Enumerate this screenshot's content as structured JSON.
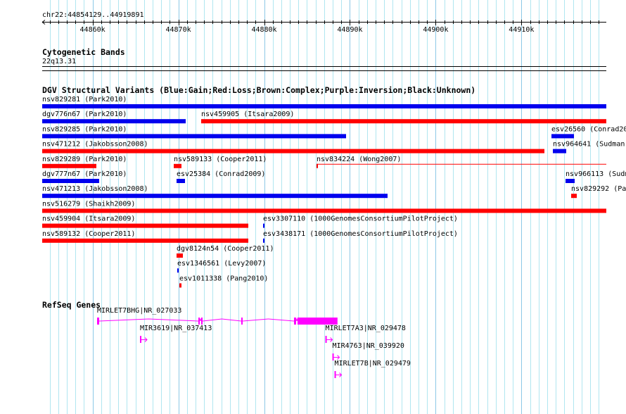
{
  "ruler": {
    "location": "chr22:44854129..44919891",
    "start": 44854129,
    "end": 44919891,
    "tick_labels": [
      {
        "bp": 44860000,
        "label": "44860k"
      },
      {
        "bp": 44870000,
        "label": "44870k"
      },
      {
        "bp": 44880000,
        "label": "44880k"
      },
      {
        "bp": 44890000,
        "label": "44890k"
      },
      {
        "bp": 44900000,
        "label": "44900k"
      },
      {
        "bp": 44910000,
        "label": "44910k"
      }
    ]
  },
  "colors": {
    "gain": "#0000ee",
    "loss": "#ff0000",
    "gene": "#ff00ff",
    "grid_minor": "#b0e6f0",
    "grid_major": "#8cc8e6"
  },
  "cytoband": {
    "title": "Cytogenetic Bands",
    "band": "22q13.31"
  },
  "dgv": {
    "title": "DGV Structural Variants (Blue:Gain;Red:Loss;Brown:Complex;Purple:Inversion;Black:Unknown)",
    "rows": [
      [
        {
          "label": "nsv829281 (Park2010)",
          "type": "gain",
          "start": 44854129,
          "end": 44919891
        }
      ],
      [
        {
          "label": "dgv776n67 (Park2010)",
          "type": "gain",
          "start": 44854129,
          "end": 44870857
        },
        {
          "label": "nsv459905 (Itsara2009)",
          "type": "loss",
          "start": 44872661,
          "end": 44919891
        }
      ],
      [
        {
          "label": "nsv829285 (Park2010)",
          "type": "gain",
          "start": 44854129,
          "end": 44889553
        },
        {
          "label": "esv26560 (Conrad20",
          "type": "gain",
          "start": 44913497,
          "end": 44916121
        }
      ],
      [
        {
          "label": "nsv471212 (Jakobsson2008)",
          "type": "loss",
          "start": 44854129,
          "end": 44912677
        },
        {
          "label": "nsv964641 (Sudman",
          "type": "gain",
          "start": 44913661,
          "end": 44915219
        }
      ],
      [
        {
          "label": "nsv829289 (Park2010)",
          "type": "loss",
          "start": 44854129,
          "end": 44860443
        },
        {
          "label": "nsv589133 (Cooper2011)",
          "type": "loss",
          "start": 44869463,
          "end": 44870365
        },
        {
          "label": "nsv834224 (Wong2007)",
          "type": "loss",
          "start": 44886109,
          "end": 44919891,
          "thin": true
        }
      ],
      [
        {
          "label": "dgv777n67 (Park2010)",
          "type": "gain",
          "start": 44854129,
          "end": 44860771
        },
        {
          "label": "esv25384 (Conrad2009)",
          "type": "gain",
          "start": 44869791,
          "end": 44870775
        },
        {
          "label": "nsv966113 (Sudm",
          "type": "gain",
          "start": 44915137,
          "end": 44916203
        }
      ],
      [
        {
          "label": "nsv471213 (Jakobsson2008)",
          "type": "gain",
          "start": 44854129,
          "end": 44894391
        },
        {
          "label": "nsv829292 (Pa",
          "type": "loss",
          "start": 44915793,
          "end": 44916449
        }
      ],
      [
        {
          "label": "nsv516279 (Shaikh2009)",
          "type": "loss",
          "start": 44854129,
          "end": 44919891
        }
      ],
      [
        {
          "label": "nsv459904 (Itsara2009)",
          "type": "loss",
          "start": 44854129,
          "end": 44878155
        },
        {
          "label": "esv3307110 (1000GenomesConsortiumPilotProject)",
          "type": "gain",
          "start": 44879877,
          "end": 44880041
        }
      ],
      [
        {
          "label": "nsv589132 (Cooper2011)",
          "type": "loss",
          "start": 44854129,
          "end": 44878155
        },
        {
          "label": "esv3438171 (1000GenomesConsortiumPilotProject)",
          "type": "gain",
          "start": 44879877,
          "end": 44880041
        }
      ],
      [
        {
          "label": "dgv8124n54 (Cooper2011)",
          "type": "loss",
          "start": 44869791,
          "end": 44870529
        }
      ],
      [
        {
          "label": "esv1346561 (Levy2007)",
          "type": "gain",
          "start": 44869873,
          "end": 44870037
        }
      ],
      [
        {
          "label": "esv1011338 (Pang2010)",
          "type": "loss",
          "start": 44870119,
          "end": 44870365
        }
      ]
    ]
  },
  "refseq": {
    "title": "RefSeq Genes",
    "genes": [
      {
        "label": "MIRLET7BHG|NR_027033",
        "start": 44860525,
        "end": 44888553,
        "strand": "+",
        "exons": [
          [
            44860525,
            44860771
          ],
          [
            44872333,
            44872497
          ],
          [
            44872661,
            44872825
          ],
          [
            44877333,
            44877497
          ],
          [
            44883483,
            44883729
          ],
          [
            44883893,
            44888553
          ]
        ]
      },
      {
        "label": "MIR3619|NR_037413",
        "start": 44865527,
        "end": 44865627,
        "strand": "+"
      },
      {
        "label": "MIRLET7A3|NR_029478",
        "start": 44887137,
        "end": 44887237,
        "strand": "+"
      },
      {
        "label": "MIR4763|NR_039920",
        "start": 44887957,
        "end": 44888057,
        "strand": "+"
      },
      {
        "label": "MIRLET7B|NR_029479",
        "start": 44888203,
        "end": 44888303,
        "strand": "+"
      }
    ]
  }
}
